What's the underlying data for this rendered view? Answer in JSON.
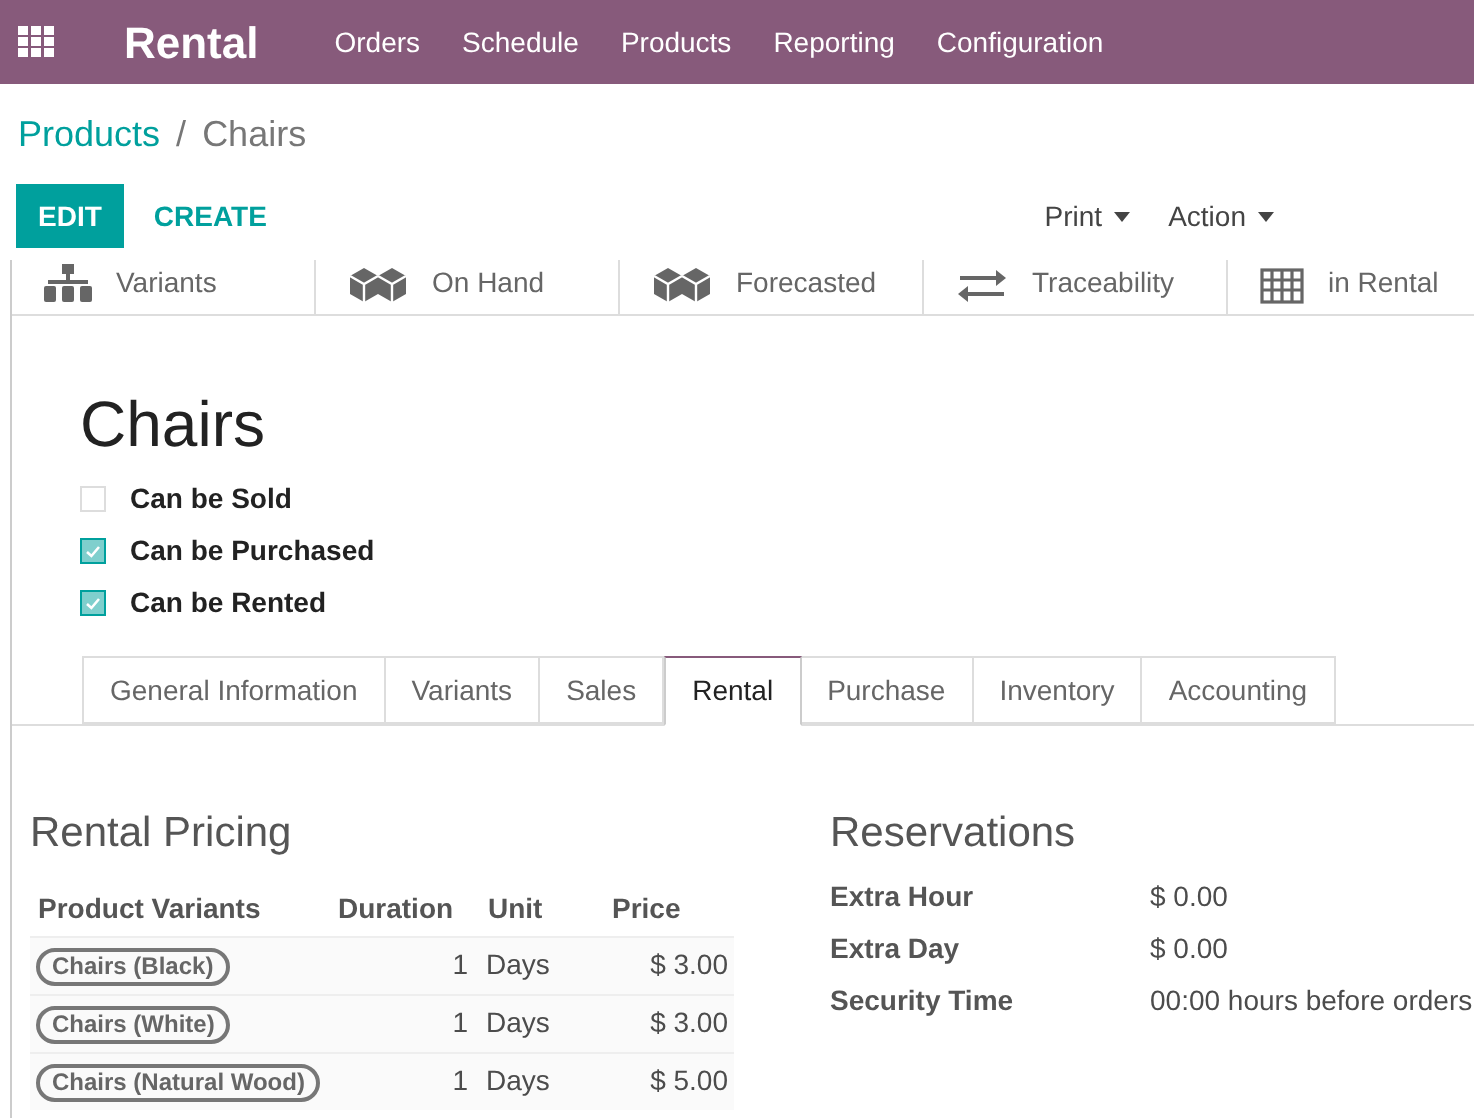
{
  "navbar": {
    "app": "Rental",
    "menu": [
      "Orders",
      "Schedule",
      "Products",
      "Reporting",
      "Configuration"
    ]
  },
  "breadcrumb": {
    "parent": "Products",
    "separator": "/",
    "current": "Chairs"
  },
  "actions": {
    "edit": "EDIT",
    "create": "CREATE",
    "dropdowns": [
      "Print",
      "Action"
    ]
  },
  "stat_buttons": [
    {
      "kind": "variants",
      "label": "Variants"
    },
    {
      "kind": "cubes",
      "label": "On Hand"
    },
    {
      "kind": "cubes",
      "label": "Forecasted"
    },
    {
      "kind": "arrows",
      "label": "Traceability"
    },
    {
      "kind": "grid",
      "label": "in Rental"
    }
  ],
  "product": {
    "name": "Chairs",
    "options": [
      {
        "label": "Can be Sold",
        "checked": false
      },
      {
        "label": "Can be Purchased",
        "checked": true
      },
      {
        "label": "Can be Rented",
        "checked": true
      }
    ]
  },
  "tabs": [
    {
      "label": "General Information",
      "selected": false
    },
    {
      "label": "Variants",
      "selected": false
    },
    {
      "label": "Sales",
      "selected": false
    },
    {
      "label": "Rental",
      "selected": true
    },
    {
      "label": "Purchase",
      "selected": false
    },
    {
      "label": "Inventory",
      "selected": false
    },
    {
      "label": "Accounting",
      "selected": false
    }
  ],
  "rental_pricing": {
    "title": "Rental Pricing",
    "columns": [
      "Product Variants",
      "Duration",
      "Unit",
      "Price"
    ],
    "rows": [
      {
        "variant": "Chairs (Black)",
        "duration": "1",
        "unit": "Days",
        "price": "$ 3.00"
      },
      {
        "variant": "Chairs (White)",
        "duration": "1",
        "unit": "Days",
        "price": "$ 3.00"
      },
      {
        "variant": "Chairs (Natural Wood)",
        "duration": "1",
        "unit": "Days",
        "price": "$ 5.00"
      }
    ]
  },
  "reservations": {
    "title": "Reservations",
    "fields": [
      {
        "label": "Extra Hour",
        "value": "$ 0.00"
      },
      {
        "label": "Extra Day",
        "value": "$ 0.00"
      },
      {
        "label": "Security Time",
        "value": "00:00 hours before orders"
      }
    ]
  }
}
